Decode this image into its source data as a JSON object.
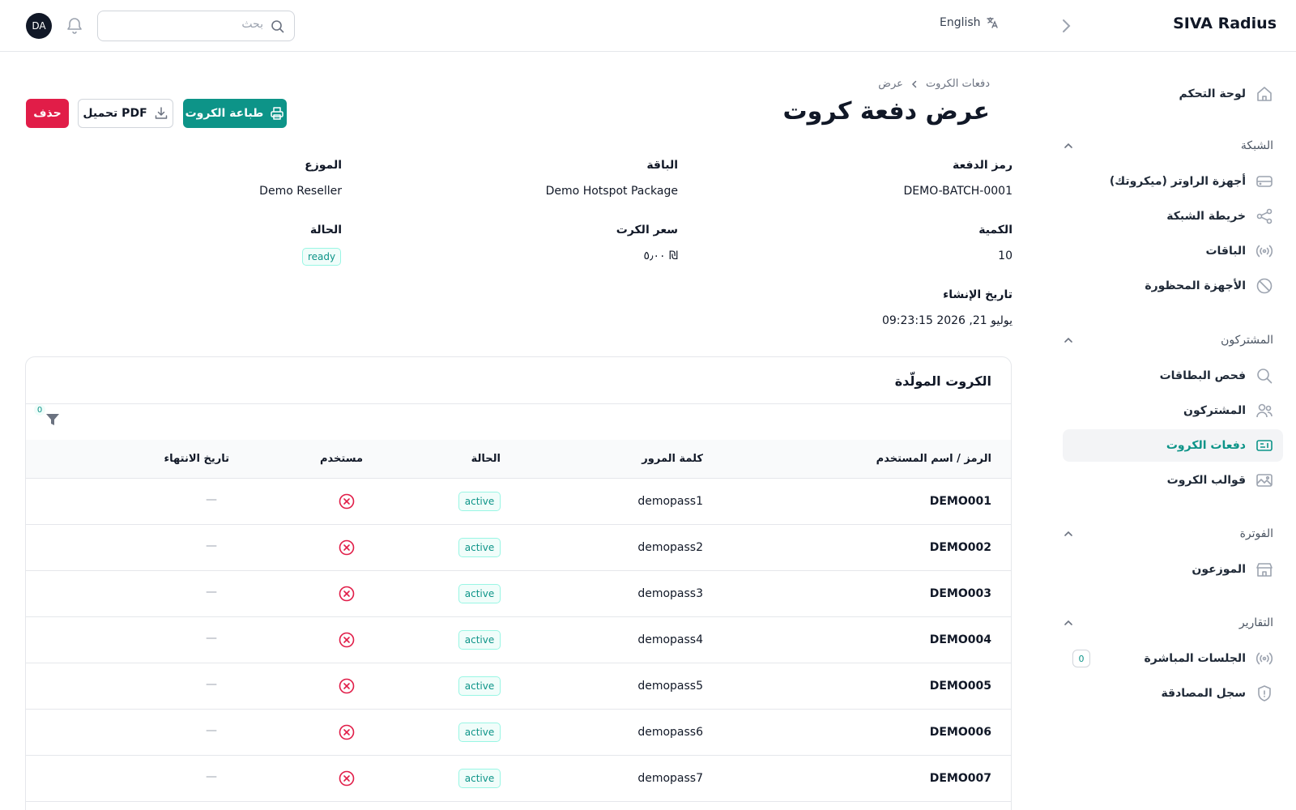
{
  "topbar": {
    "brand": "SIVA Radius",
    "language": "English",
    "search_placeholder": "بحث",
    "avatar_initials": "DA"
  },
  "sidebar": {
    "dashboard": "لوحة التحكم",
    "sections": [
      {
        "title": "الشبكة",
        "items": [
          "أجهزة الراوتر (ميكروتك)",
          "خريطة الشبكة",
          "الباقات",
          "الأجهزة المحظورة"
        ]
      },
      {
        "title": "المشتركون",
        "items": [
          "فحص البطاقات",
          "المشتركون",
          "دفعات الكروت",
          "قوالب الكروت"
        ]
      },
      {
        "title": "الفوترة",
        "items": [
          "الموزعون"
        ]
      },
      {
        "title": "التقارير",
        "items": [
          "الجلسات المباشرة",
          "سجل المصادقة"
        ]
      }
    ],
    "live_sessions_count": "0",
    "active_item": "دفعات الكروت"
  },
  "breadcrumb": {
    "parent": "دفعات الكروت",
    "current": "عرض"
  },
  "page": {
    "title": "عرض دفعة كروت"
  },
  "actions": {
    "print": "طباعة الكروت",
    "pdf": "تحميل PDF",
    "delete": "حذف"
  },
  "details": {
    "batch_code_label": "رمز الدفعة",
    "batch_code": "DEMO-BATCH-0001",
    "package_label": "الباقة",
    "package": "Demo Hotspot Package",
    "reseller_label": "الموزع",
    "reseller": "Demo Reseller",
    "quantity_label": "الكمية",
    "quantity": "10",
    "price_label": "سعر الكرت",
    "price": "٥٫٠٠ ₪",
    "status_label": "الحالة",
    "status": "ready",
    "created_label": "تاريخ الإنشاء",
    "created": "يوليو 21, 2026 09:23:15"
  },
  "cards_table": {
    "title": "الكروت المولّدة",
    "filter_count": "0",
    "columns": {
      "code": "الرمز / اسم المستخدم",
      "password": "كلمة المرور",
      "status": "الحالة",
      "used": "مستخدم",
      "expires": "تاريخ الانتهاء"
    },
    "rows": [
      {
        "code": "DEMO001",
        "password": "demopass1",
        "status": "active",
        "expires": "—"
      },
      {
        "code": "DEMO002",
        "password": "demopass2",
        "status": "active",
        "expires": "—"
      },
      {
        "code": "DEMO003",
        "password": "demopass3",
        "status": "active",
        "expires": "—"
      },
      {
        "code": "DEMO004",
        "password": "demopass4",
        "status": "active",
        "expires": "—"
      },
      {
        "code": "DEMO005",
        "password": "demopass5",
        "status": "active",
        "expires": "—"
      },
      {
        "code": "DEMO006",
        "password": "demopass6",
        "status": "active",
        "expires": "—"
      },
      {
        "code": "DEMO007",
        "password": "demopass7",
        "status": "active",
        "expires": "—"
      }
    ]
  },
  "colors": {
    "accent": "#0d9488",
    "danger": "#e11d48"
  }
}
